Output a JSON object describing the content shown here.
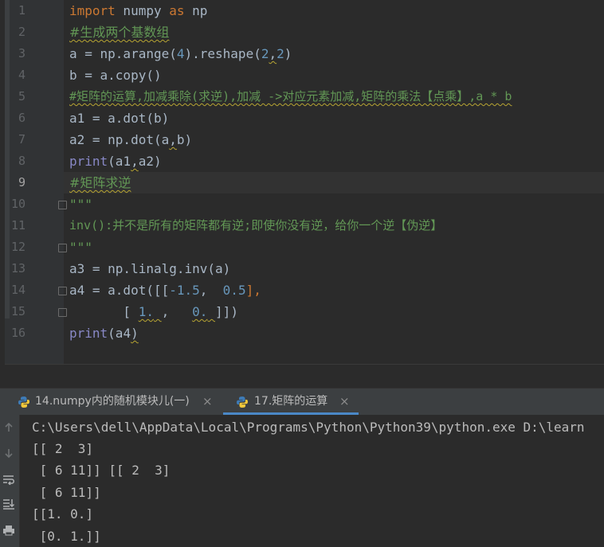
{
  "editor": {
    "line_numbers": [
      "1",
      "2",
      "3",
      "4",
      "5",
      "6",
      "7",
      "8",
      "9",
      "10",
      "11",
      "12",
      "13",
      "14",
      "15",
      "16"
    ],
    "current_line": "9"
  },
  "code": {
    "l1_kw1": "import",
    "l1_mod": " numpy ",
    "l1_kw2": "as",
    "l1_alias": " np",
    "l2": "#生成两个基数组",
    "l3_a": "a = np.arange(",
    "l3_n1": "4",
    "l3_b": ").reshape(",
    "l3_n2": "2",
    "l3_c": ",",
    "l3_n3": "2",
    "l3_d": ")",
    "l4": "b = a.copy()",
    "l5": "#矩阵的运算,加减乘除(求逆),加减 ->对应元素加减,矩阵的乘法【点乘】,a * b",
    "l6": "a1 = a.dot(b)",
    "l7_a": "a2 = np.dot(a",
    "l7_b": ",",
    "l7_c": "b)",
    "l8_fn": "print",
    "l8_a": "(a1",
    "l8_b": ",",
    "l8_c": "a2)",
    "l9": "#矩阵求逆",
    "l10": "\"\"\"",
    "l11": "inv():并不是所有的矩阵都有逆;即使你没有逆，给你一个逆【伪逆】",
    "l12": "\"\"\"",
    "l13": "a3 = np.linalg.inv(a)",
    "l14_a": "a4 = a.dot([[",
    "l14_n1": "-1.5",
    "l14_b": ",  ",
    "l14_n2": "0.5",
    "l14_c": "],",
    "l15_pad": "       [ ",
    "l15_n1": "1.",
    "l15_s1": " ",
    "l15_b": ",   ",
    "l15_n2": "0.",
    "l15_s2": " ",
    "l15_c": "]])",
    "l16_fn": "print",
    "l16_a": "(a4",
    "l16_b": ")"
  },
  "run": {
    "tabs": [
      {
        "label": "14.numpy内的随机模块儿(一)",
        "close": "×"
      },
      {
        "label": "17.矩阵的运算",
        "close": "×"
      }
    ],
    "toolbar_icons": [
      "arrow-up-icon",
      "arrow-down-icon",
      "soft-wrap-icon",
      "scroll-to-end-icon",
      "print-icon"
    ]
  },
  "console": {
    "lines": [
      "C:\\Users\\dell\\AppData\\Local\\Programs\\Python\\Python39\\python.exe D:\\learn",
      "[[ 2  3]",
      " [ 6 11]] [[ 2  3]",
      " [ 6 11]]",
      "[[1. 0.]",
      " [0. 1.]]"
    ]
  }
}
